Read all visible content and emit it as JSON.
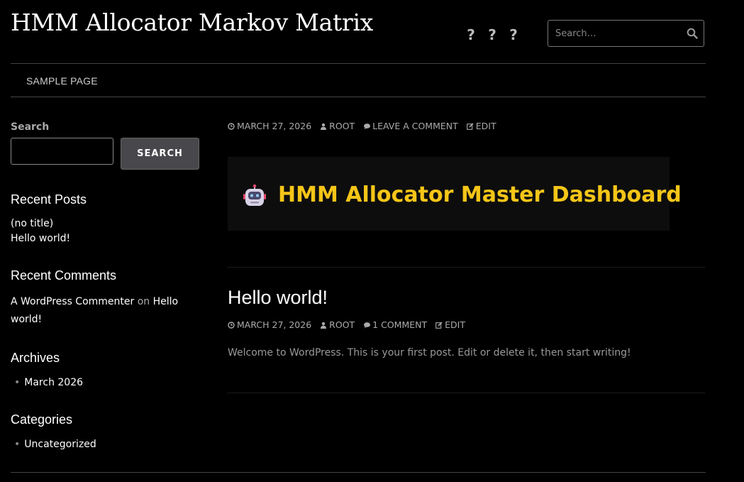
{
  "site": {
    "title": "HMM Allocator Markov Matrix"
  },
  "header": {
    "social_icons": [
      "?",
      "?",
      "?"
    ],
    "search_placeholder": "Search…"
  },
  "nav": {
    "items": [
      "SAMPLE PAGE"
    ]
  },
  "sidebar": {
    "search_label": "Search",
    "search_button": "SEARCH",
    "recent_posts_heading": "Recent Posts",
    "recent_posts": [
      "(no title)",
      "Hello world!"
    ],
    "recent_comments_heading": "Recent Comments",
    "recent_comment": {
      "author": "A WordPress Commenter",
      "on": "on",
      "post": "Hello world!"
    },
    "archives_heading": "Archives",
    "archives": [
      "March 2026"
    ],
    "categories_heading": "Categories",
    "categories": [
      "Uncategorized"
    ]
  },
  "posts": [
    {
      "date": "MARCH 27, 2026",
      "author": "ROOT",
      "comments": "LEAVE A COMMENT",
      "edit": "EDIT",
      "banner_title": "HMM Allocator Master Dashboard"
    },
    {
      "title": "Hello world!",
      "date": "MARCH 27, 2026",
      "author": "ROOT",
      "comments": "1 COMMENT",
      "edit": "EDIT",
      "body": "Welcome to WordPress. This is your first post. Edit or delete it, then start writing!"
    }
  ],
  "colors": {
    "background": "#000000",
    "accent": "#f5c518",
    "muted": "#aaaaaa"
  }
}
